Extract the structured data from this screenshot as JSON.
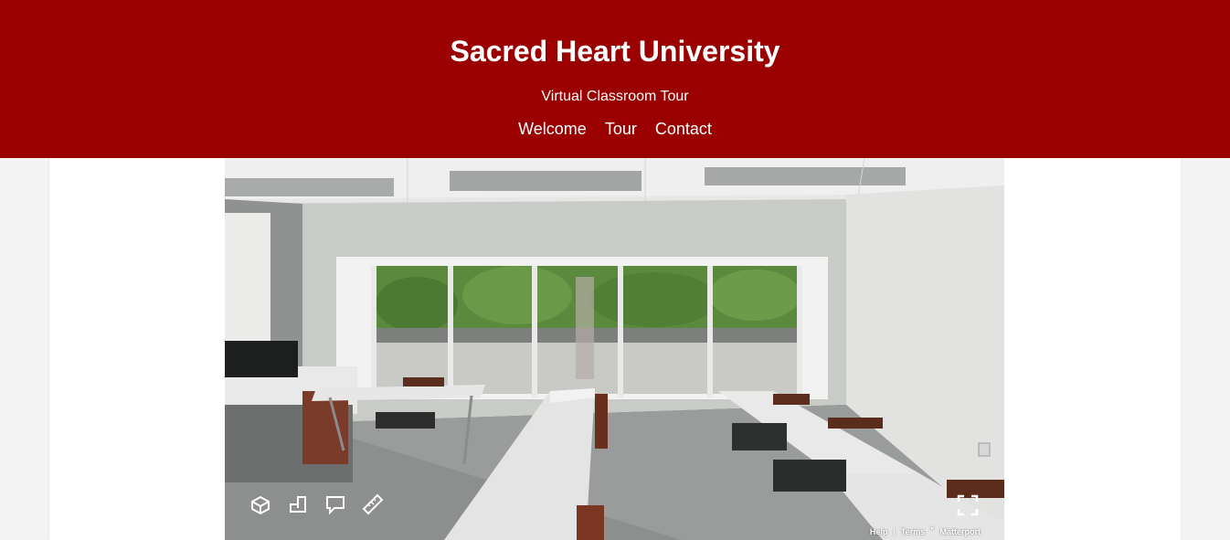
{
  "header": {
    "title": "Sacred Heart University",
    "subtitle": "Virtual Classroom Tour",
    "nav": [
      {
        "label": "Welcome"
      },
      {
        "label": "Tour"
      },
      {
        "label": "Contact"
      }
    ]
  },
  "viewer": {
    "controls": [
      {
        "icon": "dollhouse-icon"
      },
      {
        "icon": "floorplan-icon"
      },
      {
        "icon": "mattertag-icon"
      },
      {
        "icon": "measure-icon"
      },
      {
        "icon": "fullscreen-icon"
      }
    ],
    "footer": {
      "help": "Help",
      "terms": "Terms",
      "brand": "Matterport"
    }
  },
  "colors": {
    "header_bg": "#9b0000",
    "page_bg": "#f4f4f4"
  }
}
